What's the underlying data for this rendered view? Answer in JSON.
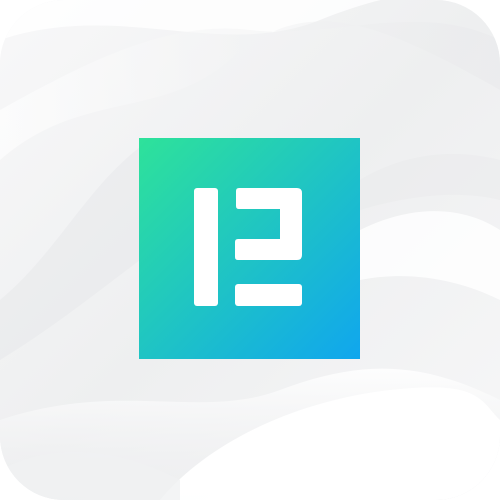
{
  "icon": {
    "name": "app-icon",
    "glyph": "logo-mark-icon",
    "colors": {
      "background": "#f4f5f6",
      "gradient_start": "#2ee29a",
      "gradient_end": "#10a6ee",
      "glyph": "#ffffff"
    }
  }
}
